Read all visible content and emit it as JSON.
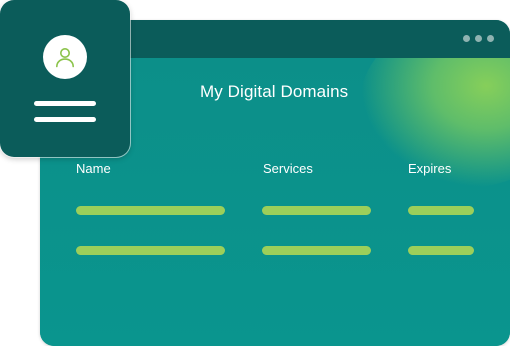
{
  "window": {
    "title": "My Digital Domains",
    "table": {
      "columns": [
        "Name",
        "Services",
        "Expires"
      ],
      "rows": 2
    }
  },
  "colors": {
    "window_bg": "#0a8c86",
    "titlebar": "#0b5c5a",
    "placeholder_bar": "#9ccf5a",
    "accent_glow": "#86cf5a",
    "avatar_icon": "#8bc34a"
  },
  "icons": {
    "avatar": "user-icon",
    "window_menu": "more-dots-icon"
  }
}
